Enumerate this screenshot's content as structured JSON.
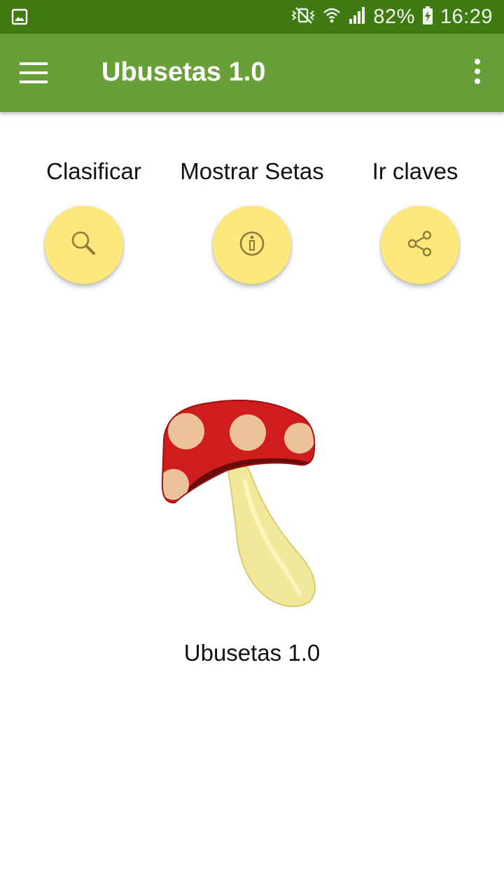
{
  "status_bar": {
    "battery": "82%",
    "time": "16:29",
    "icons": [
      "gallery-icon",
      "vibrate-mute-icon",
      "wifi-icon",
      "signal-icon",
      "battery-charging-icon"
    ]
  },
  "app_bar": {
    "title": "Ubusetas 1.0",
    "menu_icon": "hamburger-menu-icon",
    "overflow_icon": "more-vert-icon"
  },
  "actions": [
    {
      "label": "Clasificar",
      "icon": "search-icon"
    },
    {
      "label": "Mostrar Setas",
      "icon": "info-icon"
    },
    {
      "label": "Ir claves",
      "icon": "share-icon"
    }
  ],
  "logo": {
    "caption": "Ubusetas 1.0",
    "image": "mushroom-icon"
  },
  "colors": {
    "status_bar": "#3f7a13",
    "app_bar": "#689f38",
    "fab": "#fde87b",
    "mushroom_cap": "#d01c1c",
    "mushroom_stem": "#f1e89a"
  }
}
